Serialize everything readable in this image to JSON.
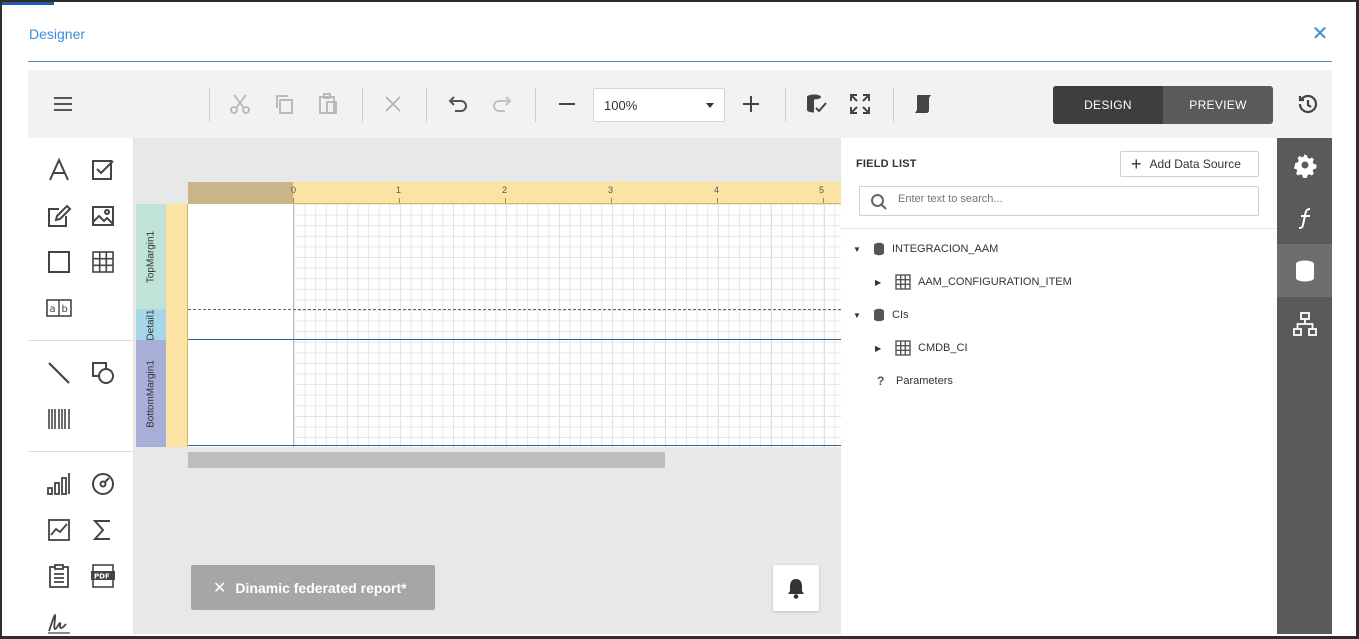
{
  "dialog": {
    "title": "Designer",
    "close_glyph": "✕"
  },
  "toolbar": {
    "zoom_value": "100%",
    "design_label": "DESIGN",
    "preview_label": "PREVIEW",
    "icons": [
      "menu-icon",
      "cut-icon",
      "copy-icon",
      "paste-icon",
      "delete-icon",
      "undo-icon",
      "redo-icon",
      "zoom-out-icon",
      "zoom-in-icon",
      "validate-bindings-icon",
      "fullscreen-icon",
      "script-icon",
      "history-icon"
    ]
  },
  "toolbox": {
    "icons": [
      "label",
      "checkbox",
      "rich-text",
      "picture",
      "panel",
      "table",
      "character-comb",
      "line",
      "shape",
      "barcode",
      "chart",
      "gauge",
      "sparkline",
      "summary",
      "table-of-contents",
      "pdf-content",
      "signature"
    ]
  },
  "ruler": {
    "labels": [
      "0",
      "1",
      "2",
      "3",
      "4",
      "5"
    ]
  },
  "bands": {
    "top_margin": "TopMargin1",
    "detail": "Detail1",
    "bottom_margin": "BottomMargin1"
  },
  "report_tab": {
    "label": "Dinamic federated report*",
    "close_glyph": "✕"
  },
  "field_list": {
    "title": "FIELD LIST",
    "add_button": "Add Data Source",
    "search_placeholder": "Enter text to search...",
    "tree": [
      {
        "label": "INTEGRACION_AAM",
        "child": "AAM_CONFIGURATION_ITEM"
      },
      {
        "label": "CIs",
        "child": "CMDB_CI"
      }
    ],
    "parameters_label": "Parameters"
  },
  "colors": {
    "accent": "#3b8fd9",
    "dark": "#5a5a5a",
    "ruler": "#fbe3a3",
    "band_top": "#bfe3d9",
    "band_detail": "#a7d6e8",
    "band_bottom": "#a7afd8"
  }
}
